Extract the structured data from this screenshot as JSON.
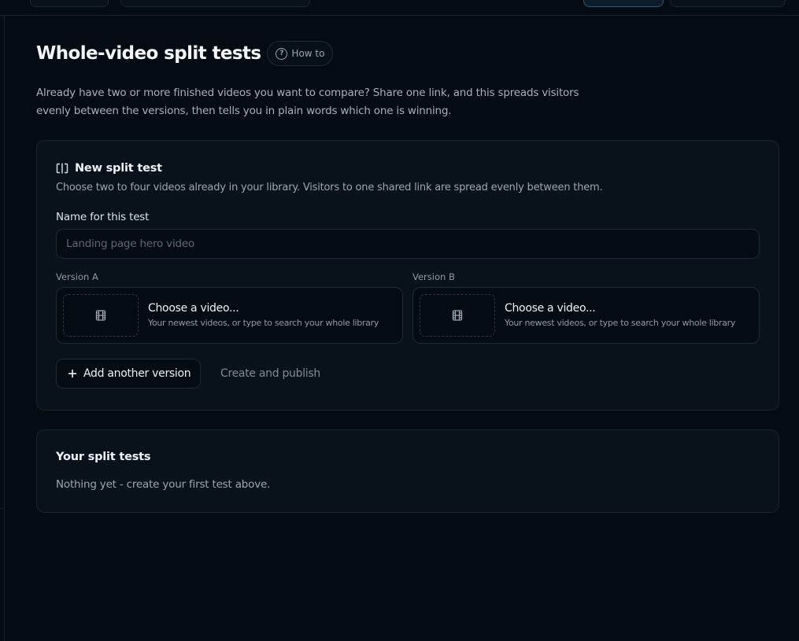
{
  "page": {
    "title": "Whole-video split tests",
    "how_to_label": "How to",
    "intro": "Already have two or more finished videos you want to compare? Share one link, and this spreads visitors evenly between the versions, then tells you in plain words which one is winning."
  },
  "new_test": {
    "title": "New split test",
    "subtitle": "Choose two to four videos already in your library. Visitors to one shared link are spread evenly between them.",
    "name_label": "Name for this test",
    "name_value": "",
    "name_placeholder": "Landing page hero video",
    "versions": [
      {
        "label": "Version A",
        "picker_title": "Choose a video...",
        "picker_hint": "Your newest videos, or type to search your whole library"
      },
      {
        "label": "Version B",
        "picker_title": "Choose a video...",
        "picker_hint": "Your newest videos, or type to search your whole library"
      }
    ],
    "add_version_label": "Add another version",
    "publish_label": "Create and publish"
  },
  "tests_list": {
    "title": "Your split tests",
    "empty_text": "Nothing yet - create your first test above."
  },
  "icons": {
    "split": "split-columns-icon",
    "help": "question-circle-icon",
    "film": "film-icon",
    "add": "plus-icon"
  },
  "colors": {
    "background": "#050b12",
    "card": "#09121b",
    "border": "#1e2a35",
    "text": "#dce3ea",
    "muted": "#9aa6b2",
    "active_tab_border": "#33546a"
  }
}
